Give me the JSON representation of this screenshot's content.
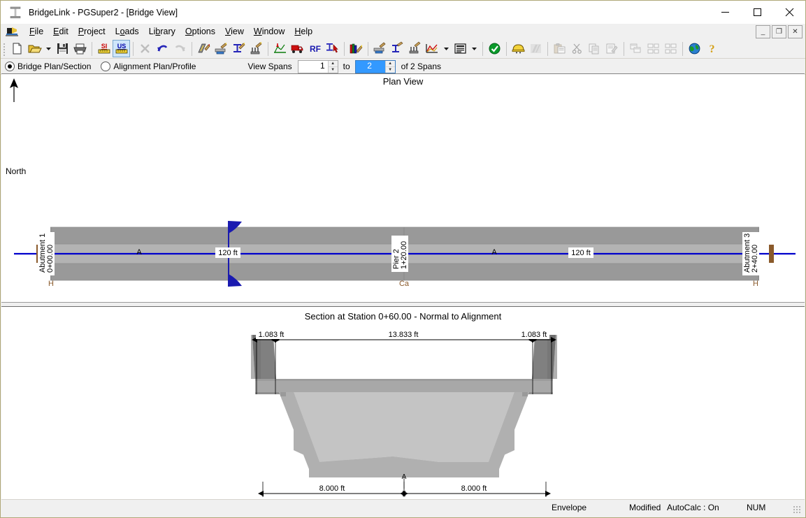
{
  "window": {
    "title": "BridgeLink - PGSuper2 - [Bridge View]",
    "app_icon": "bridge-girder-icon",
    "minimize": "—",
    "maximize": "☐",
    "close": "✕",
    "mdi_minimize": "_",
    "mdi_restore": "❐",
    "mdi_close": "✕"
  },
  "menu": {
    "icon": "pgsuper-doc-icon",
    "items": [
      {
        "label": "File",
        "pre": "",
        "key": "F",
        "post": "ile"
      },
      {
        "label": "Edit",
        "pre": "",
        "key": "E",
        "post": "dit"
      },
      {
        "label": "Project",
        "pre": "",
        "key": "P",
        "post": "roject"
      },
      {
        "label": "Loads",
        "pre": "L",
        "key": "o",
        "post": "ads"
      },
      {
        "label": "Library",
        "pre": "Li",
        "key": "b",
        "post": "rary"
      },
      {
        "label": "Options",
        "pre": "",
        "key": "O",
        "post": "ptions"
      },
      {
        "label": "View",
        "pre": "",
        "key": "V",
        "post": "iew"
      },
      {
        "label": "Window",
        "pre": "",
        "key": "W",
        "post": "indow"
      },
      {
        "label": "Help",
        "pre": "",
        "key": "H",
        "post": "elp"
      }
    ]
  },
  "toolbar": {
    "buttons": [
      {
        "name": "new-file-icon",
        "kind": "newdoc",
        "state": "normal"
      },
      {
        "name": "open-file-icon",
        "kind": "open",
        "state": "normal"
      },
      {
        "name": "open-dropdown-icon",
        "kind": "dropdown",
        "state": "normal"
      },
      {
        "name": "save-icon",
        "kind": "save",
        "state": "normal"
      },
      {
        "name": "print-icon",
        "kind": "print",
        "state": "normal"
      },
      {
        "sep": true
      },
      {
        "name": "si-units-icon",
        "kind": "si",
        "state": "normal"
      },
      {
        "name": "us-units-icon",
        "kind": "us",
        "state": "active"
      },
      {
        "sep": true
      },
      {
        "name": "delete-icon",
        "kind": "delete",
        "state": "disabled"
      },
      {
        "name": "undo-icon",
        "kind": "undo",
        "state": "normal"
      },
      {
        "name": "redo-icon",
        "kind": "redo",
        "state": "disabled"
      },
      {
        "sep": true
      },
      {
        "name": "edit-roadway-icon",
        "kind": "roadway",
        "state": "normal"
      },
      {
        "name": "edit-deck-icon",
        "kind": "deck",
        "state": "normal"
      },
      {
        "name": "edit-girder-icon",
        "kind": "girder",
        "state": "normal"
      },
      {
        "name": "edit-pier-icon",
        "kind": "pier",
        "state": "normal"
      },
      {
        "sep": true
      },
      {
        "name": "loads-icon",
        "kind": "loads",
        "state": "normal"
      },
      {
        "name": "live-load-truck-icon",
        "kind": "truck",
        "state": "normal"
      },
      {
        "name": "rating-icon",
        "kind": "rf",
        "state": "normal"
      },
      {
        "name": "girder-selection-icon",
        "kind": "gsel",
        "state": "normal"
      },
      {
        "sep": true
      },
      {
        "name": "library-editor-icon",
        "kind": "library",
        "state": "normal"
      },
      {
        "sep": true
      },
      {
        "name": "deck-view-icon",
        "kind": "deckview",
        "state": "normal"
      },
      {
        "name": "girder-view-icon",
        "kind": "gview",
        "state": "normal"
      },
      {
        "name": "pier-view-icon",
        "kind": "pview",
        "state": "normal"
      },
      {
        "name": "graph-view-icon",
        "kind": "graph",
        "state": "normal"
      },
      {
        "name": "graph-dropdown-icon",
        "kind": "dropdown",
        "state": "normal"
      },
      {
        "name": "report-view-icon",
        "kind": "report",
        "state": "normal"
      },
      {
        "name": "report-dropdown-icon",
        "kind": "dropdown",
        "state": "normal"
      },
      {
        "sep": true
      },
      {
        "name": "design-check-icon",
        "kind": "check",
        "state": "normal"
      },
      {
        "sep": true
      },
      {
        "name": "design-girder-icon",
        "kind": "hardhat",
        "state": "normal"
      },
      {
        "name": "effective-flange-icon",
        "kind": "flange",
        "state": "disabled"
      },
      {
        "sep": true
      },
      {
        "name": "paste-icon",
        "kind": "paste",
        "state": "disabled"
      },
      {
        "name": "cut-icon",
        "kind": "cut",
        "state": "disabled"
      },
      {
        "name": "copy-icon",
        "kind": "copy",
        "state": "disabled"
      },
      {
        "name": "edit-item-icon",
        "kind": "edititem",
        "state": "disabled"
      },
      {
        "sep": true
      },
      {
        "name": "cascade-windows-icon",
        "kind": "cascade",
        "state": "disabled"
      },
      {
        "name": "tile-horizontal-icon",
        "kind": "tileh",
        "state": "disabled"
      },
      {
        "name": "tile-vertical-icon",
        "kind": "tilev",
        "state": "disabled"
      },
      {
        "sep": true
      },
      {
        "name": "web-help-icon",
        "kind": "globe",
        "state": "normal"
      },
      {
        "name": "help-icon",
        "kind": "help",
        "state": "normal"
      }
    ]
  },
  "viewbar": {
    "radio_bridge": "Bridge Plan/Section",
    "radio_alignment": "Alignment Plan/Profile",
    "selected": "bridge",
    "view_spans_label": "View Spans",
    "span_from": "1",
    "span_to": "2",
    "to_label": "to",
    "of_spans_label": "of 2 Spans"
  },
  "plan_view": {
    "title": "Plan View",
    "north_label": "North",
    "left_abutment": {
      "name": "Abutment 1",
      "station": "0+00.00",
      "connection": "H"
    },
    "pier": {
      "name": "Pier 2",
      "station": "1+20.00",
      "connection": "Ca"
    },
    "right_abutment": {
      "name": "Abutment 3",
      "station": "2+40.00",
      "connection": "H"
    },
    "span1": {
      "girder_label": "A",
      "length": "120 ft"
    },
    "span2": {
      "girder_label": "A",
      "length": "120 ft"
    },
    "section_cut_label": "120 ft"
  },
  "section_view": {
    "title": "Section at Station 0+60.00 - Normal to Alignment",
    "left_barrier_dim": "1.083 ft",
    "roadway_dim": "13.833 ft",
    "right_barrier_dim": "1.083 ft",
    "left_girder_dim": "8.000 ft",
    "right_girder_dim": "8.000 ft",
    "alignment_label": "A"
  },
  "statusbar": {
    "envelope": "Envelope",
    "modified": "Modified",
    "autocalc": "AutoCalc : On",
    "num": "NUM"
  },
  "colors": {
    "deck_outer": "#999999",
    "deck_inner": "#b3b3b3",
    "alignment_line": "#0000cc",
    "abutment": "#8a5a2b",
    "connection_text": "#8a5a2b",
    "section_cut": "#1a1ab0",
    "barrier": "#808080",
    "girder": "#b0b0b0",
    "slab": "#a8a8a8",
    "accent_selected": "#3399ff"
  }
}
